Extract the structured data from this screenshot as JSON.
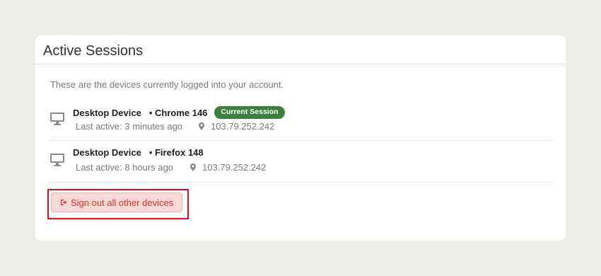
{
  "panel": {
    "title": "Active Sessions",
    "intro": "These are the devices currently logged into your account."
  },
  "sessions": [
    {
      "device": "Desktop Device",
      "browser": "• Chrome 146",
      "badge": "Current Session",
      "last_active": "Last active: 3 minutes ago",
      "ip": "103.79.252.242",
      "device_icon": "desktop-icon",
      "ip_icon": "map-pin-icon"
    },
    {
      "device": "Desktop Device",
      "browser": "• Firefox 148",
      "last_active": "Last active: 8 hours ago",
      "ip": "103.79.252.242",
      "device_icon": "desktop-icon",
      "ip_icon": "map-pin-icon"
    }
  ],
  "actions": {
    "signout_label": "Sign out all other devices",
    "signout_icon": "sign-out-icon"
  },
  "colors": {
    "badge_bg": "#3d7f3f",
    "danger_text": "#d9322d",
    "danger_bg": "#f8d9d8",
    "highlight_border": "#e0101a"
  }
}
